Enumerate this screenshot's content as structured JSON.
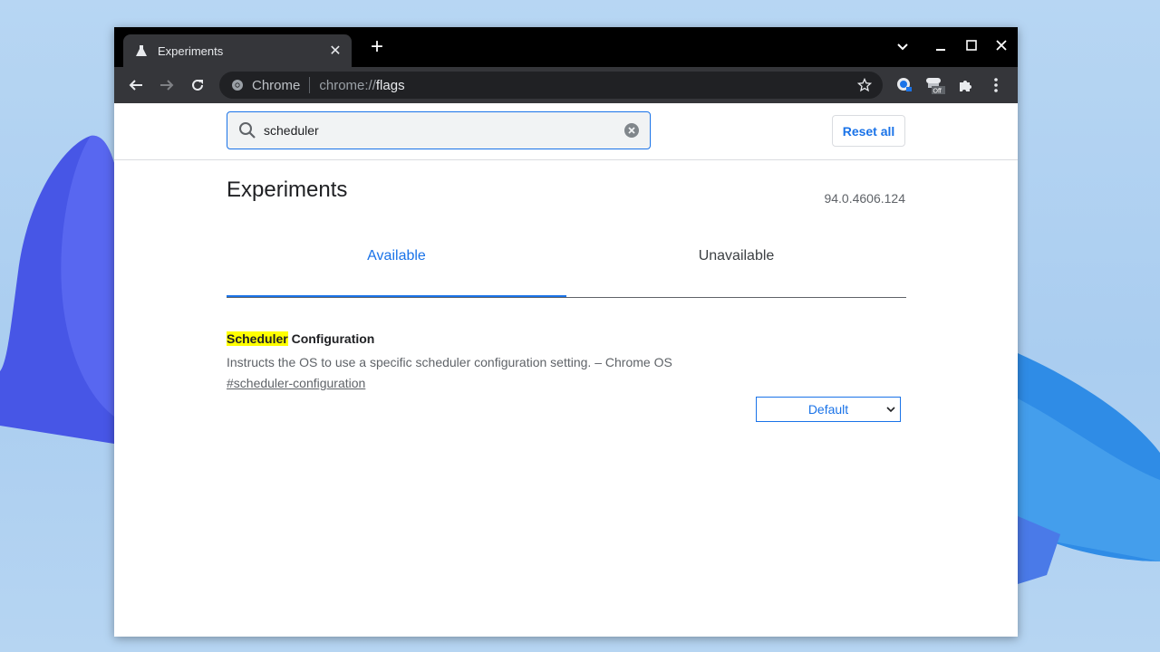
{
  "browser": {
    "tab": {
      "title": "Experiments",
      "favicon": "flask-icon"
    },
    "omnibox": {
      "site_label": "Chrome",
      "url_scheme": "chrome://",
      "url_path": "flags"
    }
  },
  "flags_page": {
    "search": {
      "value": "scheduler",
      "placeholder": "Search flags"
    },
    "reset_all_label": "Reset all",
    "title": "Experiments",
    "version": "94.0.4606.124",
    "tabs": [
      {
        "label": "Available",
        "selected": true
      },
      {
        "label": "Unavailable",
        "selected": false
      }
    ],
    "flag": {
      "title_highlight": "Scheduler",
      "title_rest": " Configuration",
      "description": "Instructs the OS to use a specific scheduler configuration setting. – Chrome OS",
      "link": "#scheduler-configuration",
      "selected_option": "Default"
    }
  },
  "colors": {
    "accent": "#1a73e8",
    "highlight": "#ffff00",
    "toolbar": "#35363a",
    "tabstrip": "#000000"
  }
}
